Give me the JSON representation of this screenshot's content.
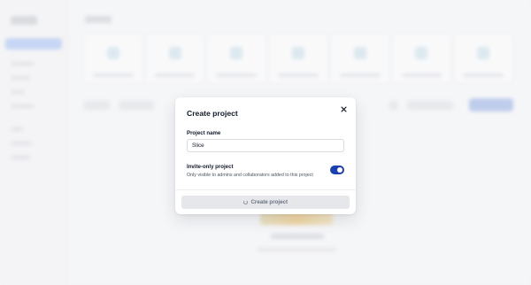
{
  "modal": {
    "title": "Create project",
    "project_name_label": "Project name",
    "project_name_value": "Slice",
    "invite_only_title": "Invite-only project",
    "invite_only_description": "Only visible to admins and collaborators added to this project",
    "invite_only_enabled": true,
    "create_button_label": "Create project",
    "create_button_loading": true
  },
  "icons": {
    "close": "close-icon",
    "spinner": "spinner-icon"
  },
  "colors": {
    "toggle_on": "#1e40af",
    "button_disabled_bg": "#e5e7eb",
    "accent_background": "#9db5e8"
  }
}
